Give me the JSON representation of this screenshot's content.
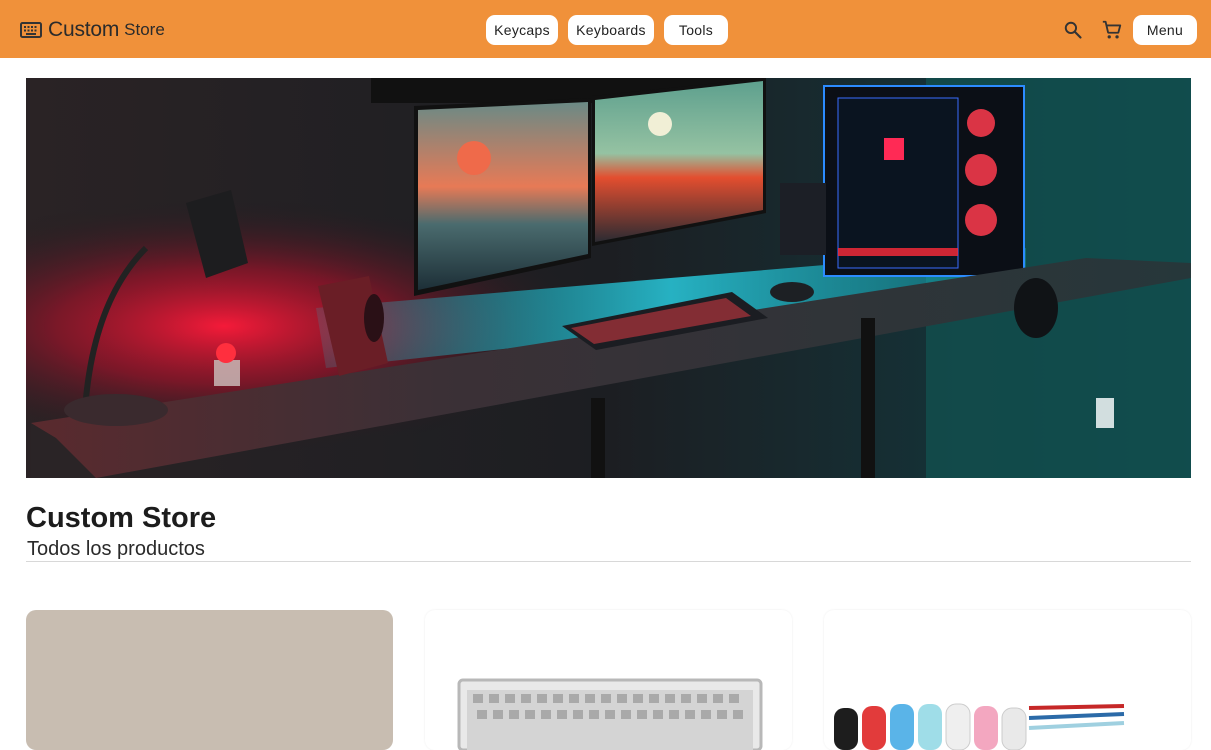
{
  "header": {
    "brand_main": "Custom",
    "brand_sub": "Store",
    "brand_icon": "keyboard-icon",
    "nav": [
      {
        "label": "Keycaps"
      },
      {
        "label": "Keyboards"
      },
      {
        "label": "Tools"
      }
    ],
    "search_icon": "search-icon",
    "cart_icon": "cart-icon",
    "menu_label": "Menu",
    "color": "#f0913a"
  },
  "hero": {
    "image": "gaming desk setup with RGB lighting"
  },
  "page": {
    "title": "Custom Store",
    "subtitle": "Todos los productos"
  },
  "products": [
    {
      "image": "beige placeholder"
    },
    {
      "image": "keyboard kit"
    },
    {
      "image": "coiled cables"
    }
  ]
}
